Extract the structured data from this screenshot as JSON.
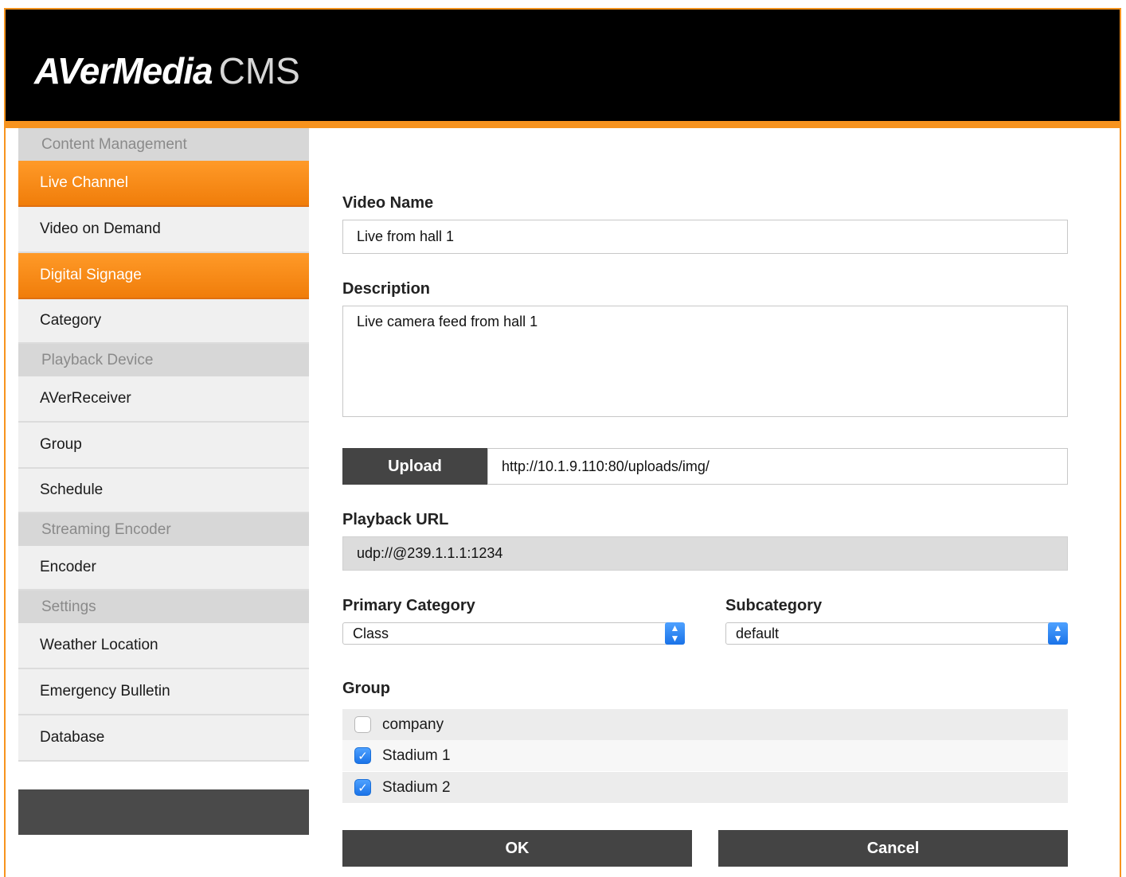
{
  "header": {
    "brand": "AVerMedia",
    "product": "CMS",
    "colors": {
      "accent": "#f7931e",
      "header_bg": "#000000"
    }
  },
  "sidebar": {
    "sections": [
      {
        "title": "Content Management",
        "items": [
          {
            "label": "Live Channel",
            "active": true
          },
          {
            "label": "Video on Demand",
            "active": false
          },
          {
            "label": "Digital Signage",
            "active": true
          },
          {
            "label": "Category",
            "active": false
          }
        ]
      },
      {
        "title": "Playback Device",
        "items": [
          {
            "label": "AVerReceiver"
          },
          {
            "label": "Group"
          },
          {
            "label": "Schedule"
          }
        ]
      },
      {
        "title": "Streaming Encoder",
        "items": [
          {
            "label": "Encoder"
          }
        ]
      },
      {
        "title": "Settings",
        "items": [
          {
            "label": "Weather Location"
          },
          {
            "label": "Emergency Bulletin"
          },
          {
            "label": "Database"
          }
        ]
      }
    ]
  },
  "form": {
    "video_name_label": "Video Name",
    "video_name_value": "Live from hall 1",
    "description_label": "Description",
    "description_value": "Live camera feed from hall 1",
    "upload_label": "Upload",
    "upload_url": "http://10.1.9.110:80/uploads/img/",
    "playback_url_label": "Playback URL",
    "playback_url_value": "udp://@239.1.1.1:1234",
    "primary_category_label": "Primary Category",
    "primary_category_value": "Class",
    "subcategory_label": "Subcategory",
    "subcategory_value": "default",
    "group_label": "Group",
    "groups": [
      {
        "label": "company",
        "checked": false
      },
      {
        "label": "Stadium 1",
        "checked": true
      },
      {
        "label": "Stadium 2",
        "checked": true
      }
    ],
    "ok_label": "OK",
    "cancel_label": "Cancel"
  }
}
